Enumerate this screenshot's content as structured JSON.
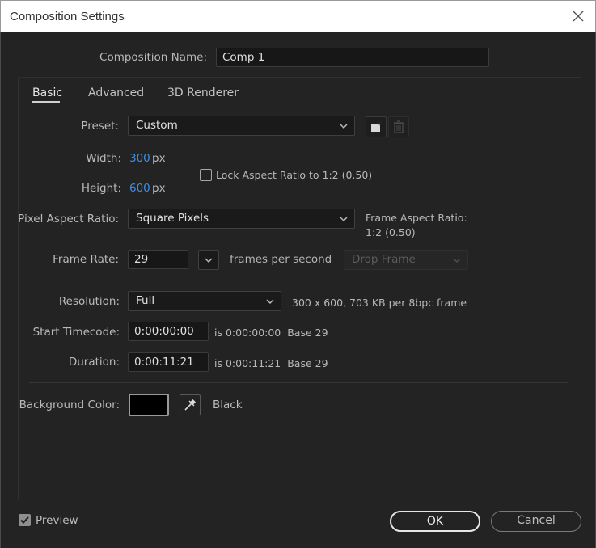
{
  "window": {
    "title": "Composition Settings"
  },
  "composition": {
    "name_label": "Composition Name:",
    "name_value": "Comp 1"
  },
  "tabs": [
    {
      "label": "Basic"
    },
    {
      "label": "Advanced"
    },
    {
      "label": "3D Renderer"
    }
  ],
  "preset": {
    "label": "Preset:",
    "value": "Custom"
  },
  "width": {
    "label": "Width:",
    "value": "300",
    "unit": "px"
  },
  "height": {
    "label": "Height:",
    "value": "600",
    "unit": "px"
  },
  "lock_aspect": {
    "label": "Lock Aspect Ratio to 1:2 (0.50)",
    "checked": false
  },
  "pixel_aspect": {
    "label": "Pixel Aspect Ratio:",
    "value": "Square Pixels"
  },
  "frame_aspect": {
    "label": "Frame Aspect Ratio:",
    "value": "1:2 (0.50)"
  },
  "frame_rate": {
    "label": "Frame Rate:",
    "value": "29",
    "unit": "frames per second",
    "drop_frame": "Drop Frame"
  },
  "resolution": {
    "label": "Resolution:",
    "value": "Full",
    "info": "300 x 600, 703 KB per 8bpc frame"
  },
  "start_timecode": {
    "label": "Start Timecode:",
    "value": "0:00:00:00",
    "info": "is 0:00:00:00  Base 29"
  },
  "duration": {
    "label": "Duration:",
    "value": "0:00:11:21",
    "info": "is 0:00:11:21  Base 29"
  },
  "background": {
    "label": "Background Color:",
    "color_name": "Black",
    "color": "#000000"
  },
  "footer": {
    "preview_label": "Preview",
    "preview_checked": true,
    "ok_label": "OK",
    "cancel_label": "Cancel"
  },
  "colors": {
    "accent_blue": "#3e8fe6",
    "dialog_bg": "#232323"
  }
}
